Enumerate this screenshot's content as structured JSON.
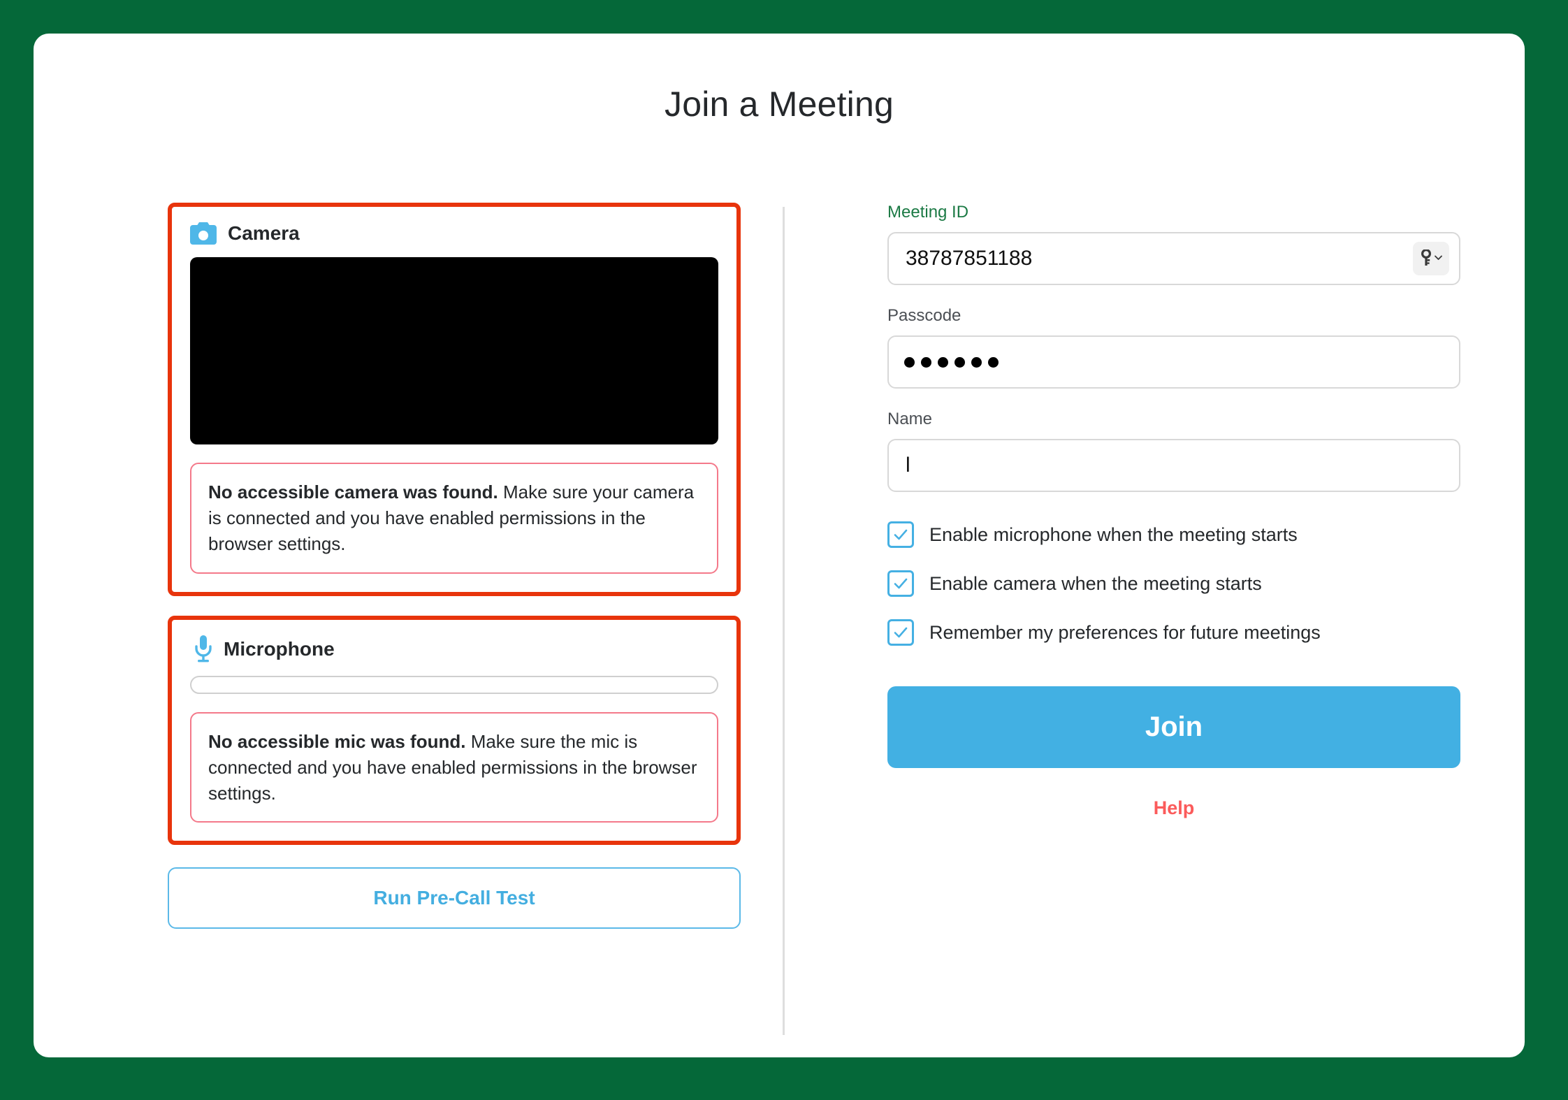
{
  "theme": {
    "background_green": "#056839",
    "card_white": "#ffffff",
    "highlight_red": "#e8340c",
    "accent_blue": "#42b0e3",
    "alert_border_pink": "#f4798a",
    "help_red": "#fb5b5b",
    "label_green": "#1c7a45"
  },
  "header": {
    "title": "Join a Meeting"
  },
  "camera_section": {
    "icon": "camera-icon",
    "label": "Camera",
    "preview_state": "black-no-signal",
    "alert": {
      "strong": "No accessible camera was found.",
      "rest": " Make sure your camera is connected and you have enabled permissions in the browser settings."
    }
  },
  "microphone_section": {
    "icon": "microphone-icon",
    "label": "Microphone",
    "level_percent": 0,
    "alert": {
      "strong": "No accessible mic was found.",
      "rest": " Make sure the mic is connected and you have enabled permissions in the browser settings."
    }
  },
  "precall": {
    "label": "Run Pre-Call Test"
  },
  "form": {
    "meeting_id": {
      "label": "Meeting ID",
      "value": "38787851188",
      "placeholder": "",
      "trailing_icon": "key-icon",
      "trailing_chevron": "chevron-down-icon"
    },
    "passcode": {
      "label": "Passcode",
      "value": "••••••",
      "masked_char_count": 6,
      "placeholder": ""
    },
    "name": {
      "label": "Name",
      "value": "l",
      "placeholder": ""
    },
    "checkboxes": [
      {
        "label": "Enable microphone when the meeting starts",
        "checked": true
      },
      {
        "label": "Enable camera when the meeting starts",
        "checked": true
      },
      {
        "label": "Remember my preferences for future meetings",
        "checked": true
      }
    ],
    "join_button": "Join",
    "help_link": "Help"
  }
}
